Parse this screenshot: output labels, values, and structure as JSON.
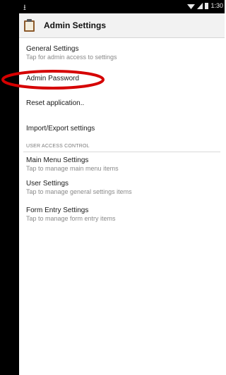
{
  "statusbar": {
    "time": "1:30",
    "download_icon": "download-icon"
  },
  "toolbar": {
    "title": "Admin Settings",
    "icon": "clipboard-icon"
  },
  "items": [
    {
      "title": "General Settings",
      "subtitle": "Tap for admin access to settings"
    },
    {
      "title": "Admin Password",
      "subtitle": ""
    },
    {
      "title": "Reset application..",
      "subtitle": ""
    },
    {
      "title": "Import/Export settings",
      "subtitle": ""
    }
  ],
  "section": {
    "label": "USER ACCESS CONTROL"
  },
  "access_items": [
    {
      "title": "Main Menu Settings",
      "subtitle": "Tap to manage main menu items"
    },
    {
      "title": "User Settings",
      "subtitle": "Tap to manage general settings items"
    },
    {
      "title": "Form Entry Settings",
      "subtitle": "Tap to manage form entry items"
    }
  ],
  "colors": {
    "annotation": "#d50000",
    "statusbar": "#000000",
    "toolbar": "#f2f2f2"
  }
}
